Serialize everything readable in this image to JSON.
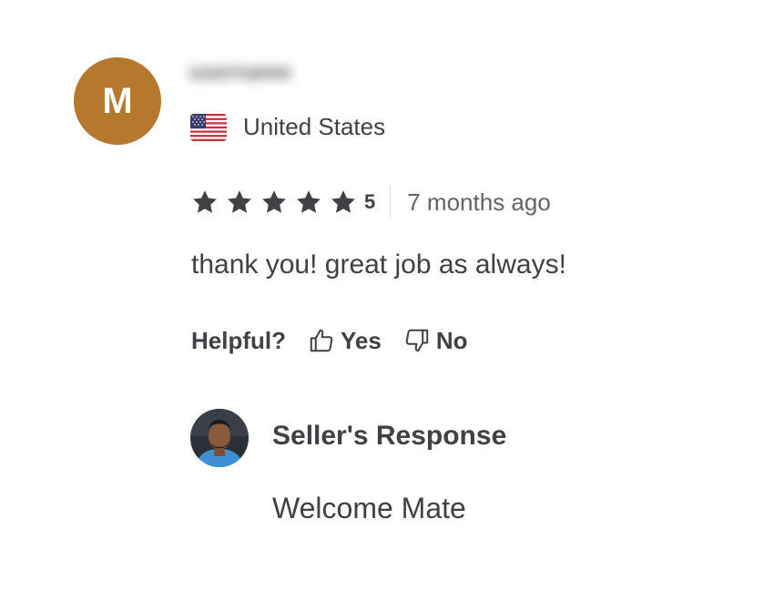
{
  "reviewer": {
    "avatar_initial": "M",
    "avatar_color": "#b5782d",
    "username_blurred": "username",
    "flag_icon": "us-flag-icon",
    "country": "United States"
  },
  "rating": {
    "stars": 5,
    "value_label": "5",
    "time_ago": "7 months ago",
    "star_icon": "star-icon",
    "star_color": "#404145"
  },
  "review": {
    "text": "thank you! great job as always!"
  },
  "helpful": {
    "label": "Helpful?",
    "yes_label": "Yes",
    "no_label": "No",
    "yes_icon": "thumbs-up-icon",
    "no_icon": "thumbs-down-icon"
  },
  "seller_response": {
    "title": "Seller's Response",
    "text": "Welcome Mate"
  }
}
